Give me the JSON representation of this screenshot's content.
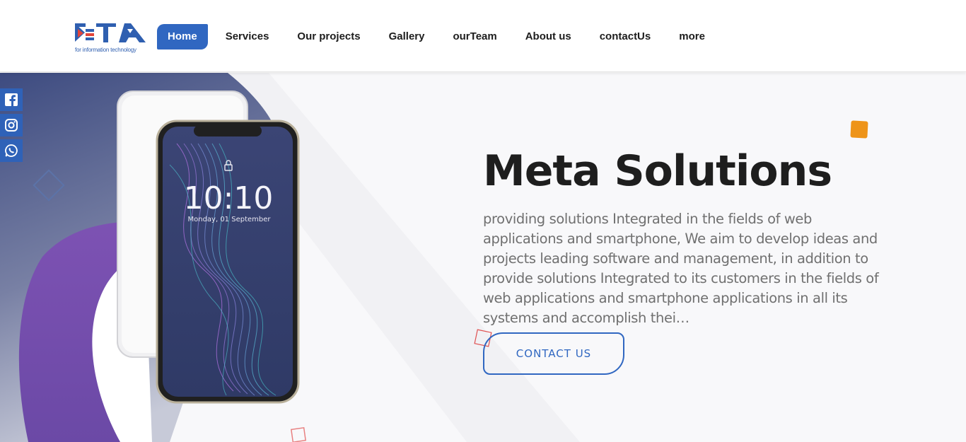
{
  "header": {
    "logo_tagline": "for information technology",
    "nav": [
      {
        "label": "Home",
        "active": true
      },
      {
        "label": "Services"
      },
      {
        "label": "Our projects"
      },
      {
        "label": "Gallery"
      },
      {
        "label": "ourTeam"
      },
      {
        "label": "About us"
      },
      {
        "label": "contactUs"
      },
      {
        "label": "more"
      }
    ]
  },
  "social": [
    {
      "icon": "facebook-icon"
    },
    {
      "icon": "instagram-icon"
    },
    {
      "icon": "whatsapp-icon"
    }
  ],
  "hero": {
    "title": "Meta Solutions",
    "description": "providing solutions Integrated in the fields of web applications and smartphone, We aim to develop ideas and projects leading software and management, in addition to provide solutions Integrated to its customers in the fields of web applications and smartphone applications in all its systems and accomplish thei…",
    "cta_label": "CONTACT US",
    "phone_time": "10:10",
    "phone_date": "Monday, 01 September"
  },
  "colors": {
    "primary": "#3067c1",
    "accent_orange": "#ee9419",
    "purple": "#7b55b5",
    "navy": "#3c4a7c"
  }
}
